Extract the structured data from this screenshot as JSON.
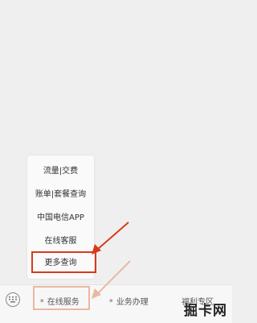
{
  "popup_menu": {
    "items": [
      {
        "label": "流量|交费"
      },
      {
        "label": "账单|套餐查询"
      },
      {
        "label": "中国电信APP"
      },
      {
        "label": "在线客服"
      },
      {
        "label": "更多查询"
      }
    ]
  },
  "bottom_menu": {
    "tabs": [
      {
        "label": "在线服务"
      },
      {
        "label": "业务办理"
      },
      {
        "label": "福利专区"
      }
    ]
  },
  "watermark": {
    "text": "掘卡网"
  },
  "colors": {
    "highlight": "#d9391b",
    "highlight_light": "#e9b8a2"
  }
}
